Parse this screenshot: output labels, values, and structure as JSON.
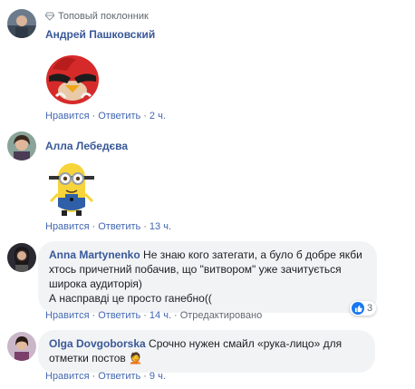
{
  "comments": [
    {
      "badge": "Топовый поклонник",
      "author": "Андрей Пашковский",
      "sticker": "angry-bird-sticker",
      "actions": {
        "like": "Нравится",
        "reply": "Ответить",
        "time": "2 ч."
      }
    },
    {
      "author": "Алла Лебедєва",
      "sticker": "minion-sticker",
      "actions": {
        "like": "Нравится",
        "reply": "Ответить",
        "time": "13 ч."
      }
    },
    {
      "author": "Anna Martynenko",
      "lines": [
        "Не знаю кого затегати, а було б добре якби",
        "хтось причетний побачив, що \"витвором\" уже зачитується",
        "широка аудиторія)",
        "А насправді це просто ганебно(("
      ],
      "reactions": {
        "icon": "like-icon",
        "count": "3"
      },
      "actions": {
        "like": "Нравится",
        "reply": "Ответить",
        "time": "14 ч.",
        "edited": "Отредактировано"
      }
    },
    {
      "author": "Olga Dovgoborska",
      "lines": [
        "Срочно нужен смайл «рука-лицо» для",
        "отметки постов"
      ],
      "emoji": "🤦",
      "actions": {
        "like": "Нравится",
        "reply": "Ответить",
        "time": "9 ч."
      }
    }
  ],
  "colors": {
    "link": "#385898",
    "action": "#4267b2",
    "meta": "#606770",
    "bubble": "#f2f3f5",
    "like": "#1877f2"
  }
}
